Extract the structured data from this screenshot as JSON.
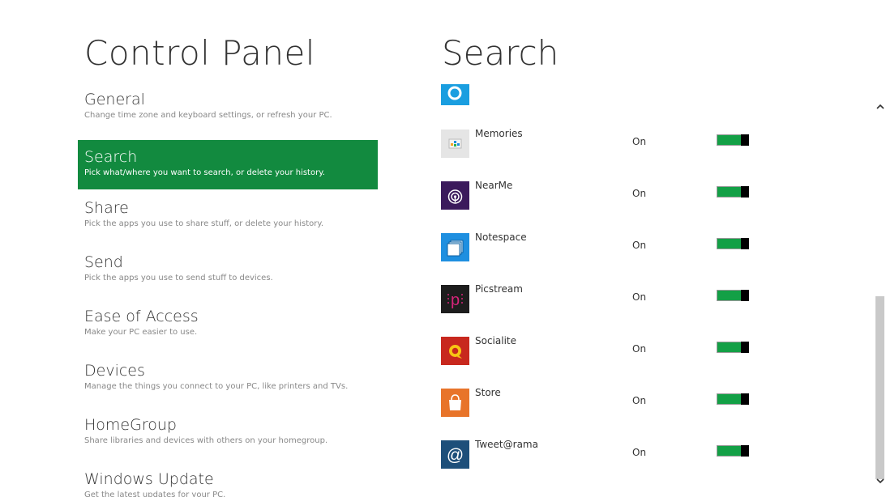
{
  "header": {
    "left_title": "Control Panel",
    "right_title": "Search"
  },
  "categories": [
    {
      "name": "General",
      "desc": "Change time zone and keyboard settings, or refresh your PC.",
      "selected": false
    },
    {
      "name": "Search",
      "desc": "Pick what/where you want to search, or delete your history.",
      "selected": true
    },
    {
      "name": "Share",
      "desc": "Pick the apps you use to share stuff, or delete your history.",
      "selected": false
    },
    {
      "name": "Send",
      "desc": "Pick the apps you use to send stuff to devices.",
      "selected": false
    },
    {
      "name": "Ease of Access",
      "desc": "Make your PC easier to use.",
      "selected": false
    },
    {
      "name": "Devices",
      "desc": "Manage the things you connect to your PC, like printers and TVs.",
      "selected": false
    },
    {
      "name": "HomeGroup",
      "desc": "Share libraries and devices with others on your homegroup.",
      "selected": false
    },
    {
      "name": "Windows Update",
      "desc": "Get the latest updates for your PC.",
      "selected": false
    }
  ],
  "apps": [
    {
      "name": "Memories",
      "status": "On",
      "enabled": true,
      "icon": "memories-icon",
      "color": "#e5e5e5"
    },
    {
      "name": "NearMe",
      "status": "On",
      "enabled": true,
      "icon": "nearme-icon",
      "color": "#3b1a5c"
    },
    {
      "name": "Notespace",
      "status": "On",
      "enabled": true,
      "icon": "notespace-icon",
      "color": "#1e8fe0"
    },
    {
      "name": "Picstream",
      "status": "On",
      "enabled": true,
      "icon": "picstream-icon",
      "color": "#1d1d1d"
    },
    {
      "name": "Socialite",
      "status": "On",
      "enabled": true,
      "icon": "socialite-icon",
      "color": "#c8281e"
    },
    {
      "name": "Store",
      "status": "On",
      "enabled": true,
      "icon": "store-icon",
      "color": "#e8742a"
    },
    {
      "name": "Tweet@rama",
      "status": "On",
      "enabled": true,
      "icon": "tweetrama-icon",
      "color": "#1d4f7a"
    }
  ],
  "colors": {
    "accent": "#128a3f",
    "toggle_on": "#13a046"
  },
  "scroll": {
    "thumb_start_fraction": 0.495,
    "thumb_size_fraction": 0.505
  }
}
